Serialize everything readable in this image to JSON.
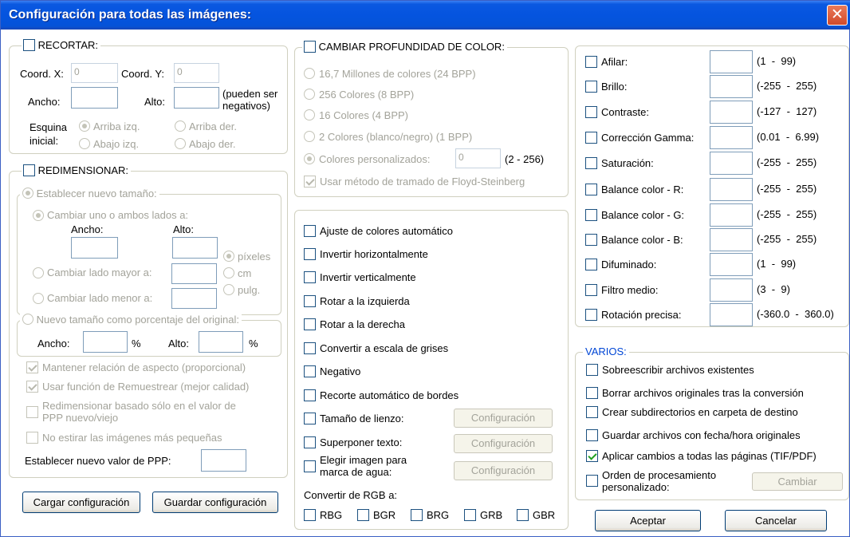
{
  "window": {
    "title": "Configuración para todas las imágenes:",
    "close_symbol": "✕"
  },
  "recortar": {
    "title": "RECORTAR:",
    "coord_x_label": "Coord. X:",
    "coord_x_value": "0",
    "coord_y_label": "Coord. Y:",
    "coord_y_value": "0",
    "ancho_label": "Ancho:",
    "alto_label": "Alto:",
    "note": "(pueden ser\nnegativos)",
    "esquina_label": "Esquina\ninicial:",
    "corners": [
      "Arriba izq.",
      "Arriba der.",
      "Abajo izq.",
      "Abajo der."
    ]
  },
  "redimensionar": {
    "title": "REDIMENSIONAR:",
    "nuevo_tamano": "Establecer nuevo tamaño:",
    "cambiar_uno": "Cambiar uno o ambos lados a:",
    "ancho_label": "Ancho:",
    "alto_label": "Alto:",
    "units": [
      "píxeles",
      "cm",
      "pulg."
    ],
    "cambiar_mayor": "Cambiar lado mayor a:",
    "cambiar_menor": "Cambiar lado menor a:",
    "porcentaje": "Nuevo tamaño como porcentaje del original:",
    "pct_ancho_label": "Ancho:",
    "pct_alto_label": "Alto:",
    "pct_symbol": "%",
    "mantener": "Mantener relación de aspecto (proporcional)",
    "remuestrear": "Usar función de Remuestrear (mejor calidad)",
    "redim_ppp": "Redimensionar basado sólo en el valor de\nPPP nuevo/viejo",
    "no_estirar": "No estirar las imágenes más pequeñas",
    "ppp_label": "Establecer nuevo valor de PPP:"
  },
  "buttons": {
    "cargar": "Cargar configuración",
    "guardar": "Guardar configuración",
    "aceptar": "Aceptar",
    "cancelar": "Cancelar"
  },
  "color_depth": {
    "title": "CAMBIAR PROFUNDIDAD DE COLOR:",
    "options": [
      "16,7 Millones de colores (24 BPP)",
      "256 Colores (8 BPP)",
      "16 Colores (4 BPP)",
      "2 Colores (blanco/negro) (1 BPP)"
    ],
    "custom_label": "Colores personalizados:",
    "custom_value": "0",
    "custom_range": "(2 - 256)",
    "floyd": "Usar método de tramado de Floyd-Steinberg"
  },
  "operations": {
    "items": [
      "Ajuste de colores automático",
      "Invertir horizontalmente",
      "Invertir verticalmente",
      "Rotar a la izquierda",
      "Rotar a la derecha",
      "Convertir a escala de grises",
      "Negativo",
      "Recorte automático de bordes"
    ],
    "lienzo": "Tamaño de lienzo:",
    "superponer": "Superponer texto:",
    "marca": "Elegir imagen para\nmarca de agua:",
    "config_btn": "Configuración",
    "rgb_label": "Convertir de RGB a:",
    "rgb_options": [
      "RBG",
      "BGR",
      "BRG",
      "GRB",
      "GBR"
    ]
  },
  "adjustments": [
    {
      "label": "Afilar:",
      "range": "(1  -  99)"
    },
    {
      "label": "Brillo:",
      "range": "(-255  -  255)"
    },
    {
      "label": "Contraste:",
      "range": "(-127  -  127)"
    },
    {
      "label": "Corrección Gamma:",
      "range": "(0.01  -  6.99)"
    },
    {
      "label": "Saturación:",
      "range": "(-255  -  255)"
    },
    {
      "label": "Balance color - R:",
      "range": "(-255  -  255)"
    },
    {
      "label": "Balance color - G:",
      "range": "(-255  -  255)"
    },
    {
      "label": "Balance color - B:",
      "range": "(-255  -  255)"
    },
    {
      "label": "Difuminado:",
      "range": "(1  -  99)"
    },
    {
      "label": "Filtro medio:",
      "range": "(3  -  9)"
    },
    {
      "label": "Rotación precisa:",
      "range": "(-360.0  -  360.0)"
    }
  ],
  "varios": {
    "title": "VARIOS:",
    "items": [
      "Sobreescribir archivos existentes",
      "Borrar archivos originales tras la conversión",
      "Crear subdirectorios en carpeta de destino",
      "Guardar archivos con fecha/hora originales",
      "Aplicar cambios a todas las páginas (TIF/PDF)"
    ],
    "orden": "Orden de procesamiento\npersonalizado:",
    "cambiar_btn": "Cambiar"
  }
}
